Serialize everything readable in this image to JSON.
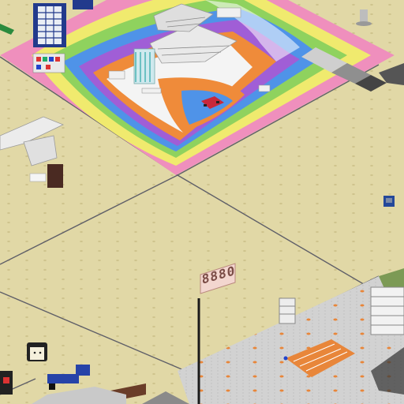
{
  "scene": {
    "view": "isometric",
    "ground_color": "#e1d8a6",
    "grid_line_color": "#5f5f68",
    "stud_color": "#cfc48d"
  },
  "rainbow_plate": {
    "band_colors": [
      "#ef8fbd",
      "#f0ea6e",
      "#8fd25e",
      "#4f93e8",
      "#a05ed6",
      "#ef8b3a",
      "#f4f4f4"
    ],
    "accent_bands": [
      "#cfcfcf",
      "#8f8f8f",
      "#444444"
    ]
  },
  "gray_plate": {
    "color": "#d2d2d2",
    "dot_color": "#e8863a"
  },
  "sign": {
    "text": "8880"
  },
  "tower": {
    "color": "#223a8c",
    "panel_color": "#e9eef5"
  },
  "figure": {
    "face_color": "#f5f0dc",
    "hair_color": "#222222"
  }
}
